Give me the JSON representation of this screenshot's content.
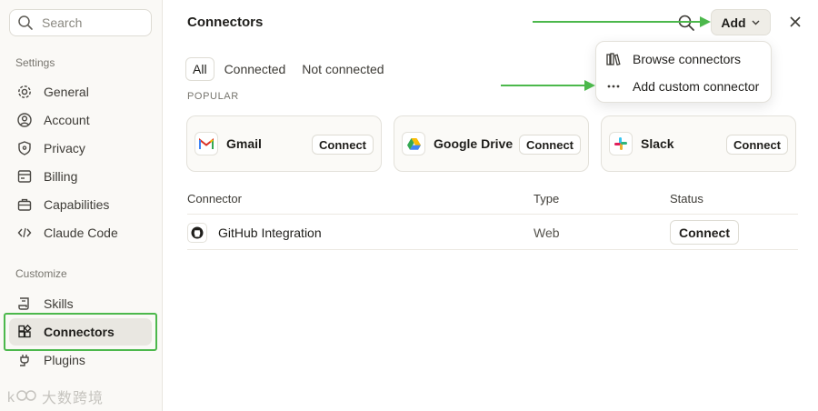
{
  "sidebar": {
    "search_placeholder": "Search",
    "settings_label": "Settings",
    "settings_items": [
      {
        "label": "General",
        "icon": "gear-icon"
      },
      {
        "label": "Account",
        "icon": "user-circle-icon"
      },
      {
        "label": "Privacy",
        "icon": "shield-icon"
      },
      {
        "label": "Billing",
        "icon": "billing-icon"
      },
      {
        "label": "Capabilities",
        "icon": "briefcase-icon"
      },
      {
        "label": "Claude Code",
        "icon": "code-icon"
      }
    ],
    "customize_label": "Customize",
    "customize_items": [
      {
        "label": "Skills",
        "icon": "scroll-icon"
      },
      {
        "label": "Connectors",
        "icon": "connectors-grid-icon",
        "active": true
      },
      {
        "label": "Plugins",
        "icon": "plug-icon"
      }
    ]
  },
  "watermark": {
    "text": "大数跨境"
  },
  "main": {
    "title": "Connectors",
    "add_label": "Add",
    "tabs": [
      {
        "label": "All",
        "active": true
      },
      {
        "label": "Connected"
      },
      {
        "label": "Not connected"
      }
    ],
    "popular_label": "POPULAR",
    "popular": [
      {
        "name": "Gmail",
        "icon": "gmail-icon",
        "button": "Connect"
      },
      {
        "name": "Google Drive",
        "icon": "google-drive-icon",
        "button": "Connect"
      },
      {
        "name": "Slack",
        "icon": "slack-icon",
        "button": "Connect"
      }
    ],
    "table": {
      "headers": [
        "Connector",
        "Type",
        "Status"
      ],
      "rows": [
        {
          "name": "GitHub Integration",
          "type": "Web",
          "button": "Connect",
          "icon": "github-icon"
        }
      ]
    }
  },
  "dropdown": {
    "items": [
      {
        "label": "Browse connectors",
        "icon": "library-icon"
      },
      {
        "label": "Add custom connector",
        "icon": "ellipsis-icon"
      }
    ]
  },
  "colors": {
    "annotation_green": "#4cb84c",
    "active_bg": "#e9e7e1",
    "sidebar_bg": "#faf9f6"
  }
}
